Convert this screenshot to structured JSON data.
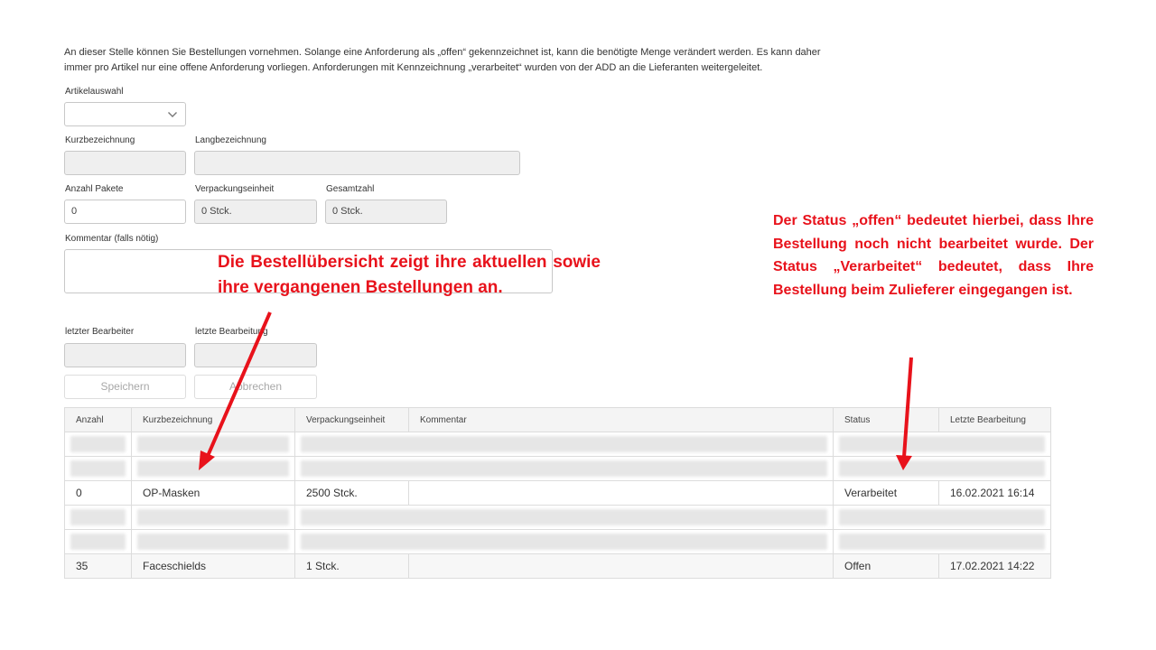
{
  "intro": {
    "line1": "An dieser Stelle können Sie Bestellungen vornehmen. Solange eine Anforderung als „offen“ gekennzeichnet ist, kann die benötigte Menge verändert werden. Es kann daher",
    "line2": "immer pro Artikel nur eine offene Anforderung vorliegen. Anforderungen mit Kennzeichnung „verarbeitet“ wurden von der ADD an die Lieferanten weitergeleitet."
  },
  "form": {
    "artikelauswahl_label": "Artikelauswahl",
    "artikelauswahl_value": "",
    "kurzbezeichnung_label": "Kurzbezeichnung",
    "kurzbezeichnung_value": "",
    "langbezeichnung_label": "Langbezeichnung",
    "langbezeichnung_value": "",
    "anzahl_pakete_label": "Anzahl Pakete",
    "anzahl_pakete_value": "0",
    "verpackungseinheit_label": "Verpackungseinheit",
    "verpackungseinheit_value": "0 Stck.",
    "gesamtzahl_label": "Gesamtzahl",
    "gesamtzahl_value": "0 Stck.",
    "kommentar_label": "Kommentar (falls nötig)",
    "kommentar_value": "",
    "letzter_bearbeiter_label": "letzter Bearbeiter",
    "letzter_bearbeiter_value": "",
    "letzte_bearbeitung_label": "letzte Bearbeitung",
    "letzte_bearbeitung_value": "",
    "save_label": "Speichern",
    "cancel_label": "Abbrechen"
  },
  "table": {
    "columns": [
      "Anzahl",
      "Kurzbezeichnung",
      "Verpackungseinheit",
      "Kommentar",
      "Status",
      "Letzte Bearbeitung"
    ],
    "rows": [
      {
        "blurred": true
      },
      {
        "blurred": true
      },
      {
        "anzahl": "0",
        "kurzbezeichnung": "OP-Masken",
        "verpackungseinheit": "2500 Stck.",
        "kommentar": "",
        "status": "Verarbeitet",
        "letzte_bearbeitung": "16.02.2021 16:14"
      },
      {
        "blurred": true
      },
      {
        "blurred": true
      },
      {
        "anzahl": "35",
        "kurzbezeichnung": "Faceschields",
        "verpackungseinheit": "1 Stck.",
        "kommentar": "",
        "status": "Offen",
        "letzte_bearbeitung": "17.02.2021 14:22"
      }
    ]
  },
  "annotations": {
    "overview": "Die Bestellübersicht zeigt ihre aktuellen sowie ihre vergangenen Bestellungen an.",
    "status": "Der Status „offen“ bedeutet hierbei, dass Ihre Bestellung noch nicht bearbeitet wurde. Der Status „Verarbeitet“ bedeutet, dass Ihre Bestellung beim Zulieferer eingegangen ist."
  },
  "colors": {
    "annotation": "#e8121b",
    "header_bg": "#f4f4f4",
    "readonly_bg": "#efefef"
  },
  "icons": {
    "select": "chevron-down-icon"
  }
}
